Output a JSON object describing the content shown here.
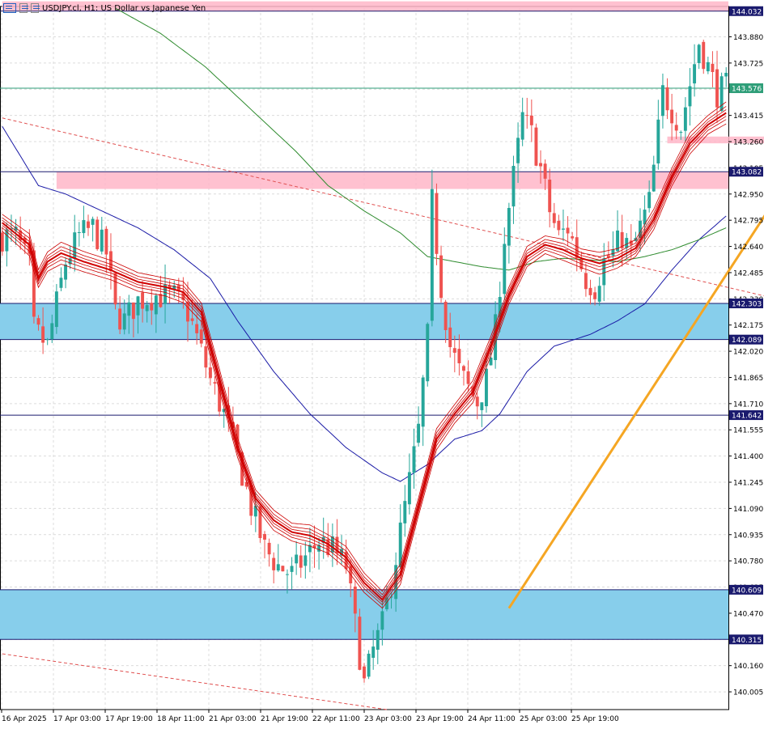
{
  "header": {
    "title": "USDJPY.cl, H1:  US Dollar vs Japanese Yen",
    "icons": [
      "symbol-icon",
      "chart-icon",
      "tick-icon"
    ]
  },
  "colors": {
    "background": "#ffffff",
    "grid": "#dcdcdc",
    "bull": "#26a69a",
    "bear": "#ef5350",
    "ribbon": "#cc0000",
    "ma_blue": "#1a1aa6",
    "ma_green": "#2e8b2e",
    "zone_blue": "#87ceeb",
    "zone_pink": "#ffb6c8",
    "trend_dashed": "#e05050",
    "arrow": "#f5a623",
    "hline_dark": "#1a1a6e",
    "hline_green": "#2e9e78"
  },
  "chart_data": {
    "type": "candlestick",
    "symbol": "USDJPY.cl",
    "timeframe": "H1",
    "ylim": [
      139.9,
      144.05
    ],
    "y_ticks": [
      "140.005",
      "140.160",
      "140.315",
      "140.470",
      "140.625",
      "140.780",
      "140.935",
      "141.090",
      "141.245",
      "141.400",
      "141.555",
      "141.710",
      "141.865",
      "142.020",
      "142.175",
      "142.330",
      "142.485",
      "142.640",
      "142.795",
      "142.950",
      "143.105",
      "143.260",
      "143.415",
      "143.570",
      "143.725",
      "143.880",
      "144.035"
    ],
    "x_ticks": [
      "16 Apr 2025",
      "17 Apr 03:00",
      "17 Apr 19:00",
      "18 Apr 11:00",
      "21 Apr 03:00",
      "21 Apr 19:00",
      "22 Apr 11:00",
      "23 Apr 03:00",
      "23 Apr 19:00",
      "24 Apr 11:00",
      "25 Apr 03:00",
      "25 Apr 19:00"
    ],
    "price_labels": [
      {
        "value": 144.032,
        "text": "144.032",
        "style": "dark"
      },
      {
        "value": 143.576,
        "text": "143.576",
        "style": "green"
      },
      {
        "value": 143.082,
        "text": "143.082",
        "style": "dark"
      },
      {
        "value": 142.303,
        "text": "142.303",
        "style": "dark"
      },
      {
        "value": 142.089,
        "text": "142.089",
        "style": "dark"
      },
      {
        "value": 141.642,
        "text": "141.642",
        "style": "dark"
      },
      {
        "value": 140.609,
        "text": "140.609",
        "style": "dark"
      },
      {
        "value": 140.315,
        "text": "140.315",
        "style": "dark"
      }
    ],
    "zones": [
      {
        "type": "support",
        "from": 142.089,
        "to": 142.303,
        "color": "blue"
      },
      {
        "type": "support",
        "from": 140.315,
        "to": 140.609,
        "color": "blue"
      },
      {
        "type": "resistance",
        "from": 142.98,
        "to": 143.08,
        "color": "pink"
      },
      {
        "type": "resistance",
        "from": 143.25,
        "to": 143.29,
        "color": "pink"
      },
      {
        "type": "resistance",
        "from": 144.032,
        "to": 144.09,
        "color": "pink"
      }
    ],
    "path_points": [
      [
        0,
        142.7
      ],
      [
        3,
        142.7
      ],
      [
        6,
        142.52
      ],
      [
        7,
        142.15
      ],
      [
        10,
        142.05
      ],
      [
        12,
        142.3
      ],
      [
        14,
        142.55
      ],
      [
        17,
        142.7
      ],
      [
        20,
        142.75
      ],
      [
        23,
        142.6
      ],
      [
        25,
        142.25
      ],
      [
        27,
        142.2
      ],
      [
        30,
        142.32
      ],
      [
        34,
        142.35
      ],
      [
        38,
        142.34
      ],
      [
        41,
        142.25
      ],
      [
        43,
        142.1
      ],
      [
        46,
        141.85
      ],
      [
        49,
        141.65
      ],
      [
        52,
        141.4
      ],
      [
        55,
        141.1
      ],
      [
        58,
        140.85
      ],
      [
        61,
        140.75
      ],
      [
        64,
        140.7
      ],
      [
        67,
        140.8
      ],
      [
        70,
        140.9
      ],
      [
        73,
        140.85
      ],
      [
        76,
        140.75
      ],
      [
        78,
        140.4
      ],
      [
        80,
        140.05
      ],
      [
        82,
        140.25
      ],
      [
        84,
        140.4
      ],
      [
        86,
        140.65
      ],
      [
        88,
        140.95
      ],
      [
        90,
        141.25
      ],
      [
        92,
        141.55
      ],
      [
        94,
        142.1
      ],
      [
        95,
        142.9
      ],
      [
        97,
        142.4
      ],
      [
        99,
        142.05
      ],
      [
        101,
        141.9
      ],
      [
        103,
        141.8
      ],
      [
        105,
        141.72
      ],
      [
        107,
        141.85
      ],
      [
        109,
        142.15
      ],
      [
        111,
        142.7
      ],
      [
        113,
        143.05
      ],
      [
        115,
        143.4
      ],
      [
        117,
        143.3
      ],
      [
        119,
        143.1
      ],
      [
        121,
        142.85
      ],
      [
        123,
        142.7
      ],
      [
        125,
        142.75
      ],
      [
        127,
        142.6
      ],
      [
        129,
        142.45
      ],
      [
        131,
        142.4
      ],
      [
        133,
        142.55
      ],
      [
        135,
        142.6
      ],
      [
        137,
        142.7
      ],
      [
        139,
        142.6
      ],
      [
        141,
        142.75
      ],
      [
        143,
        142.9
      ],
      [
        144,
        143.1
      ],
      [
        146,
        143.55
      ],
      [
        148,
        143.45
      ],
      [
        150,
        143.35
      ],
      [
        152,
        143.6
      ],
      [
        154,
        143.85
      ],
      [
        156,
        143.7
      ],
      [
        158,
        143.55
      ],
      [
        160,
        143.58
      ]
    ],
    "ribbon_ctrl": [
      [
        0,
        142.78
      ],
      [
        6,
        142.65
      ],
      [
        8,
        142.45
      ],
      [
        10,
        142.55
      ],
      [
        13,
        142.6
      ],
      [
        18,
        142.55
      ],
      [
        24,
        142.5
      ],
      [
        30,
        142.43
      ],
      [
        36,
        142.4
      ],
      [
        40,
        142.37
      ],
      [
        44,
        142.25
      ],
      [
        48,
        141.85
      ],
      [
        52,
        141.45
      ],
      [
        56,
        141.15
      ],
      [
        60,
        141.02
      ],
      [
        64,
        140.95
      ],
      [
        68,
        140.93
      ],
      [
        72,
        140.88
      ],
      [
        76,
        140.8
      ],
      [
        80,
        140.65
      ],
      [
        84,
        140.55
      ],
      [
        88,
        140.7
      ],
      [
        92,
        141.1
      ],
      [
        96,
        141.5
      ],
      [
        100,
        141.65
      ],
      [
        104,
        141.78
      ],
      [
        108,
        142.05
      ],
      [
        112,
        142.35
      ],
      [
        116,
        142.58
      ],
      [
        120,
        142.65
      ],
      [
        124,
        142.62
      ],
      [
        128,
        142.57
      ],
      [
        132,
        142.54
      ],
      [
        136,
        142.57
      ],
      [
        140,
        142.63
      ],
      [
        144,
        142.8
      ],
      [
        148,
        143.05
      ],
      [
        152,
        143.25
      ],
      [
        156,
        143.36
      ],
      [
        160,
        143.43
      ]
    ],
    "ma_blue": [
      [
        0,
        143.35
      ],
      [
        8,
        143.0
      ],
      [
        14,
        142.95
      ],
      [
        22,
        142.85
      ],
      [
        30,
        142.75
      ],
      [
        38,
        142.62
      ],
      [
        46,
        142.45
      ],
      [
        52,
        142.2
      ],
      [
        60,
        141.9
      ],
      [
        68,
        141.65
      ],
      [
        76,
        141.45
      ],
      [
        84,
        141.3
      ],
      [
        88,
        141.25
      ],
      [
        94,
        141.35
      ],
      [
        100,
        141.5
      ],
      [
        106,
        141.55
      ],
      [
        110,
        141.65
      ],
      [
        116,
        141.9
      ],
      [
        122,
        142.05
      ],
      [
        130,
        142.12
      ],
      [
        136,
        142.2
      ],
      [
        142,
        142.3
      ],
      [
        148,
        142.5
      ],
      [
        154,
        142.68
      ],
      [
        160,
        142.82
      ]
    ],
    "ma_green": [
      [
        25,
        144.05
      ],
      [
        35,
        143.9
      ],
      [
        45,
        143.7
      ],
      [
        55,
        143.45
      ],
      [
        65,
        143.2
      ],
      [
        72,
        143.0
      ],
      [
        80,
        142.85
      ],
      [
        88,
        142.72
      ],
      [
        94,
        142.58
      ],
      [
        100,
        142.55
      ],
      [
        106,
        142.52
      ],
      [
        112,
        142.5
      ],
      [
        118,
        142.55
      ],
      [
        124,
        142.57
      ],
      [
        130,
        142.56
      ],
      [
        136,
        142.55
      ],
      [
        142,
        142.58
      ],
      [
        148,
        142.62
      ],
      [
        154,
        142.68
      ],
      [
        160,
        142.75
      ]
    ],
    "dashed_trendlines": [
      {
        "from": [
          0,
          143.4
        ],
        "to": [
          200,
          142.15
        ]
      },
      {
        "from": [
          0,
          140.23
        ],
        "to": [
          85,
          139.9
        ]
      }
    ],
    "arrow": {
      "from": [
        112,
        140.5
      ],
      "to": [
        186,
        143.54
      ]
    }
  }
}
